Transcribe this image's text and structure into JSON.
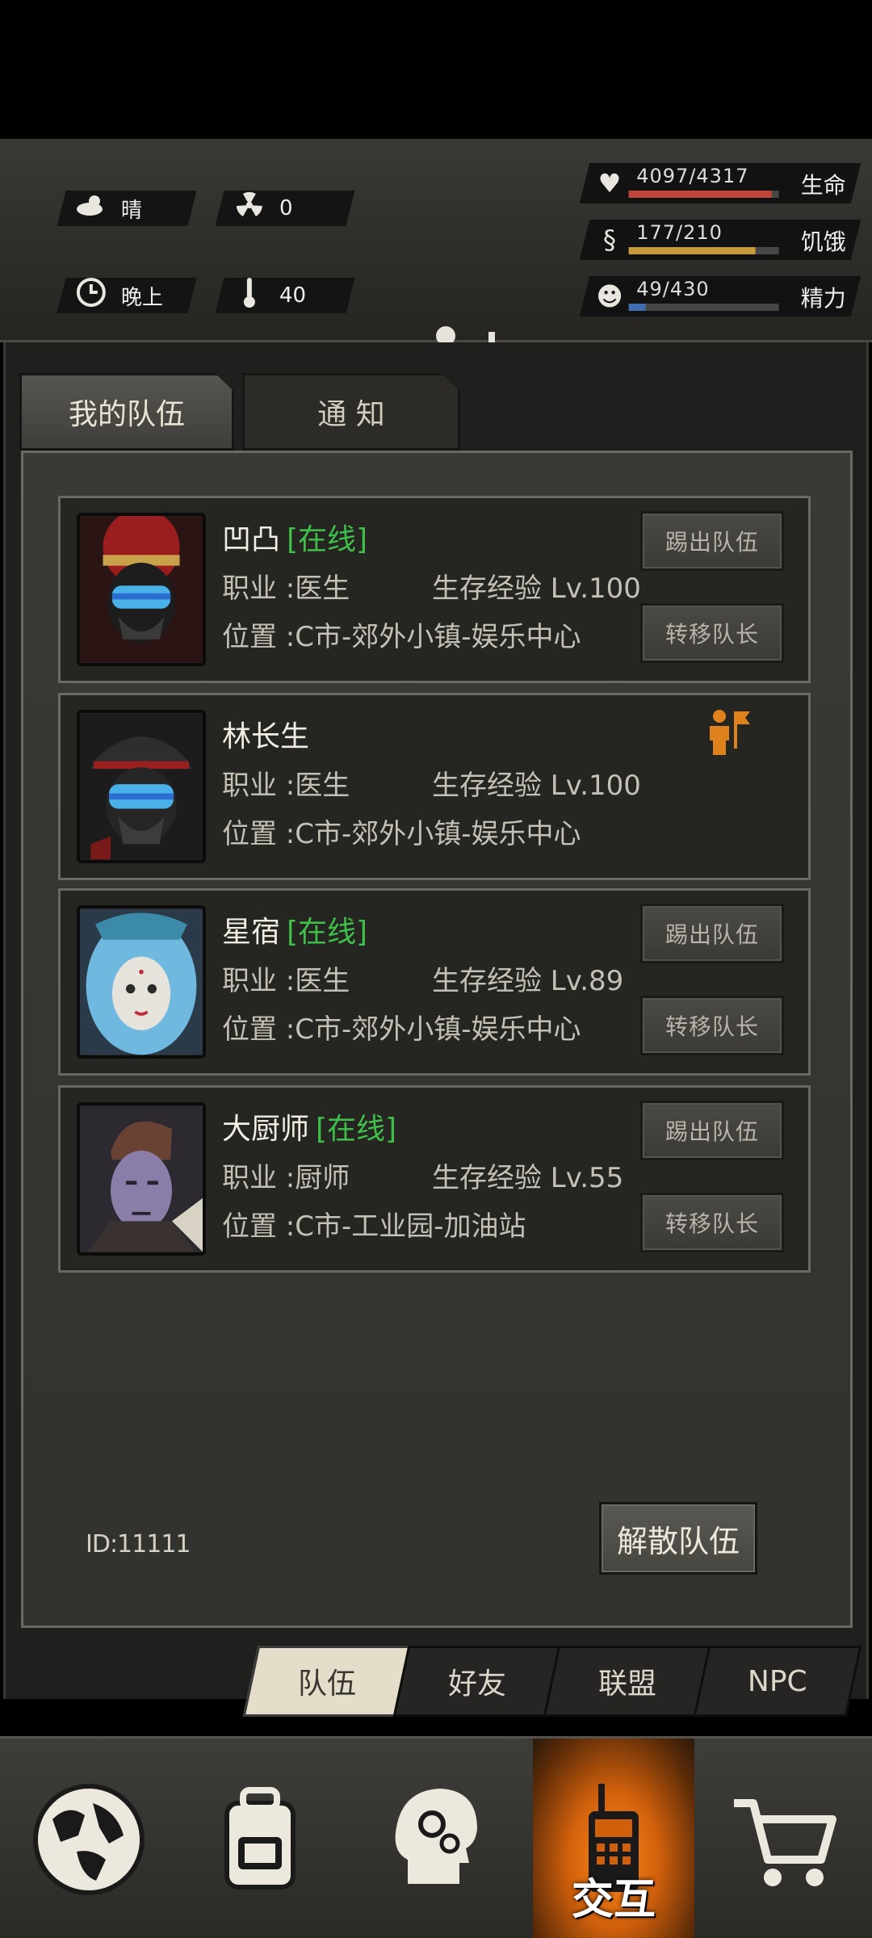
{
  "hud": {
    "weather": "晴",
    "radiation": "0",
    "time_of_day": "晚上",
    "temperature": "40",
    "stats": [
      {
        "value": "4097/4317",
        "label": "生命",
        "fraction": 0.949,
        "color": "#c0463a",
        "icon": "heart-icon"
      },
      {
        "value": "177/210",
        "label": "饥饿",
        "fraction": 0.843,
        "color": "#c79a3a",
        "icon": "stomach-icon"
      },
      {
        "value": "49/430",
        "label": "精力",
        "fraction": 0.114,
        "color": "#3f6fb0",
        "icon": "brain-icon"
      }
    ]
  },
  "tabs": {
    "my_team": "我的队伍",
    "notice": "通 知"
  },
  "members": [
    {
      "name": "凹凸",
      "online": "[在线]",
      "job": "职业 :医生",
      "exp": "生存经验 Lv.100",
      "location": "位置 :C市-郊外小镇-娱乐中心",
      "kick": "踢出队伍",
      "transfer": "转移队长",
      "avatar": "opera-mask"
    },
    {
      "name": "林长生",
      "online": "",
      "job": "职业 :医生",
      "exp": "生存经验 Lv.100",
      "location": "位置 :C市-郊外小镇-娱乐中心",
      "leader": true,
      "avatar": "officer"
    },
    {
      "name": "星宿",
      "online": "[在线]",
      "job": "职业 :医生",
      "exp": "生存经验 Lv.89",
      "location": "位置 :C市-郊外小镇-娱乐中心",
      "kick": "踢出队伍",
      "transfer": "转移队长",
      "avatar": "blue-hair"
    },
    {
      "name": "大厨师",
      "online": "[在线]",
      "job": "职业 :厨师",
      "exp": "生存经验 Lv.55",
      "location": "位置 :C市-工业园-加油站",
      "kick": "踢出队伍",
      "transfer": "转移队长",
      "avatar": "chef"
    }
  ],
  "team_id": "ID:11111",
  "disband": "解散队伍",
  "bottom_tabs": [
    "队伍",
    "好友",
    "联盟",
    "NPC"
  ],
  "footer": {
    "active_label": "交互",
    "buttons": [
      "globe-icon",
      "backpack-icon",
      "skills-head-icon",
      "radio-icon",
      "cart-icon"
    ]
  }
}
